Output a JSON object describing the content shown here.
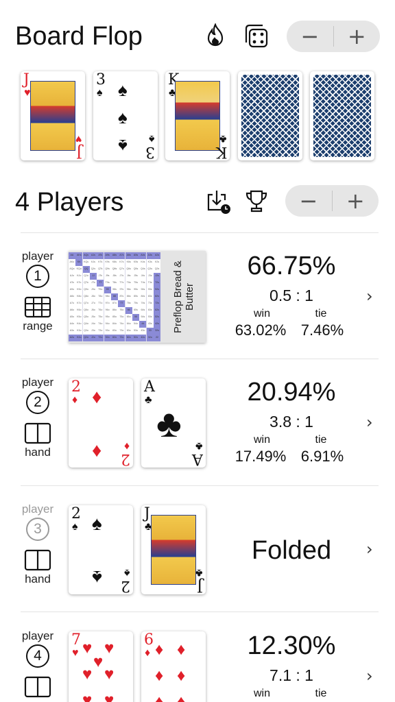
{
  "board": {
    "title": "Board Flop",
    "icons": [
      "flame-icon",
      "dice-icon"
    ],
    "stepper": {
      "minus": "−",
      "plus": "+"
    },
    "cards": [
      {
        "rank": "J",
        "suit": "♥",
        "color": "#e0202a",
        "type": "face"
      },
      {
        "rank": "3",
        "suit": "♠",
        "color": "#111111",
        "type": "pips"
      },
      {
        "rank": "K",
        "suit": "♣",
        "color": "#111111",
        "type": "face"
      },
      {
        "type": "back"
      },
      {
        "type": "back"
      }
    ]
  },
  "players_section": {
    "title": "4 Players",
    "icons": [
      "import-history-icon",
      "trophy-icon"
    ],
    "stepper": {
      "minus": "−",
      "plus": "+"
    }
  },
  "players": [
    {
      "label": "player",
      "number": "1",
      "input_type": "range",
      "range_name": "Preflop Bread & Butter",
      "equity": "66.75%",
      "odds": "0.5 : 1",
      "win_label": "win",
      "tie_label": "tie",
      "win": "63.02%",
      "tie": "7.46%",
      "folded": false
    },
    {
      "label": "player",
      "number": "2",
      "input_type": "hand",
      "cards": [
        {
          "rank": "2",
          "suit": "♦",
          "color": "#e0202a"
        },
        {
          "rank": "A",
          "suit": "♣",
          "color": "#111111"
        }
      ],
      "equity": "20.94%",
      "odds": "3.8 : 1",
      "win_label": "win",
      "tie_label": "tie",
      "win": "17.49%",
      "tie": "6.91%",
      "folded": false
    },
    {
      "label": "player",
      "number": "3",
      "input_type": "hand",
      "cards": [
        {
          "rank": "2",
          "suit": "♠",
          "color": "#111111"
        },
        {
          "rank": "J",
          "suit": "♣",
          "color": "#111111"
        }
      ],
      "status": "Folded",
      "folded": true
    },
    {
      "label": "player",
      "number": "4",
      "input_type": "hand",
      "cards": [
        {
          "rank": "7",
          "suit": "♥",
          "color": "#e0202a"
        },
        {
          "rank": "6",
          "suit": "♦",
          "color": "#e0202a"
        }
      ],
      "equity": "12.30%",
      "odds": "7.1 : 1",
      "win_label": "win",
      "tie_label": "tie",
      "folded": false
    }
  ],
  "range_grid": {
    "ranks": [
      "A",
      "K",
      "Q",
      "J",
      "T",
      "9",
      "8",
      "7",
      "6",
      "5",
      "4",
      "3",
      "2"
    ],
    "selected_color": "#8a8ad6",
    "unselected_color": "#ffffff"
  },
  "chevron": "›"
}
